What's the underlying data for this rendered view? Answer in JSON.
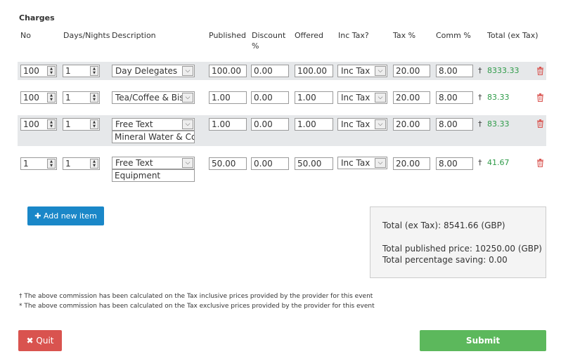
{
  "section_title": "Charges",
  "headers": {
    "no": "No",
    "days": "Days/Nights",
    "description": "Description",
    "published": "Published",
    "discount": "Discount %",
    "offered": "Offered",
    "inc_tax": "Inc Tax?",
    "tax": "Tax %",
    "comm": "Comm %",
    "total": "Total (ex Tax)"
  },
  "rows": [
    {
      "no": "100",
      "days": "1",
      "description": "Day Delegates",
      "extra_text": "",
      "published": "100.00",
      "discount": "0.00",
      "offered": "100.00",
      "inc_tax": "Inc Tax",
      "tax": "20.00",
      "comm": "8.00",
      "dagger": "†",
      "total": "8333.33"
    },
    {
      "no": "100",
      "days": "1",
      "description": "Tea/Coffee & Biscuits",
      "extra_text": "",
      "published": "1.00",
      "discount": "0.00",
      "offered": "1.00",
      "inc_tax": "Inc Tax",
      "tax": "20.00",
      "comm": "8.00",
      "dagger": "†",
      "total": "83.33"
    },
    {
      "no": "100",
      "days": "1",
      "description": "Free Text",
      "extra_text": "Mineral Water & Cordial",
      "published": "1.00",
      "discount": "0.00",
      "offered": "1.00",
      "inc_tax": "Inc Tax",
      "tax": "20.00",
      "comm": "8.00",
      "dagger": "†",
      "total": "83.33"
    },
    {
      "no": "1",
      "days": "1",
      "description": "Free Text",
      "extra_text": "Equipment",
      "published": "50.00",
      "discount": "0.00",
      "offered": "50.00",
      "inc_tax": "Inc Tax",
      "tax": "20.00",
      "comm": "8.00",
      "dagger": "†",
      "total": "41.67"
    }
  ],
  "add_button": "Add new item",
  "summary": {
    "total_ex_tax": "Total (ex Tax): 8541.66 (GBP)",
    "total_published": "Total published price: 10250.00 (GBP)",
    "saving": "Total percentage saving: 0.00"
  },
  "footnotes": [
    "† The above commission has been calculated on the Tax inclusive prices provided by the provider for this event",
    "* The above commission has been calculated on the Tax exclusive prices provided by the provider for this event"
  ],
  "quit_button": "Quit",
  "submit_button": "Submit",
  "colors": {
    "add": "#1a87c8",
    "quit": "#d9534f",
    "submit": "#5cb85c",
    "total": "#2e9b48",
    "trash": "#d9534f"
  }
}
